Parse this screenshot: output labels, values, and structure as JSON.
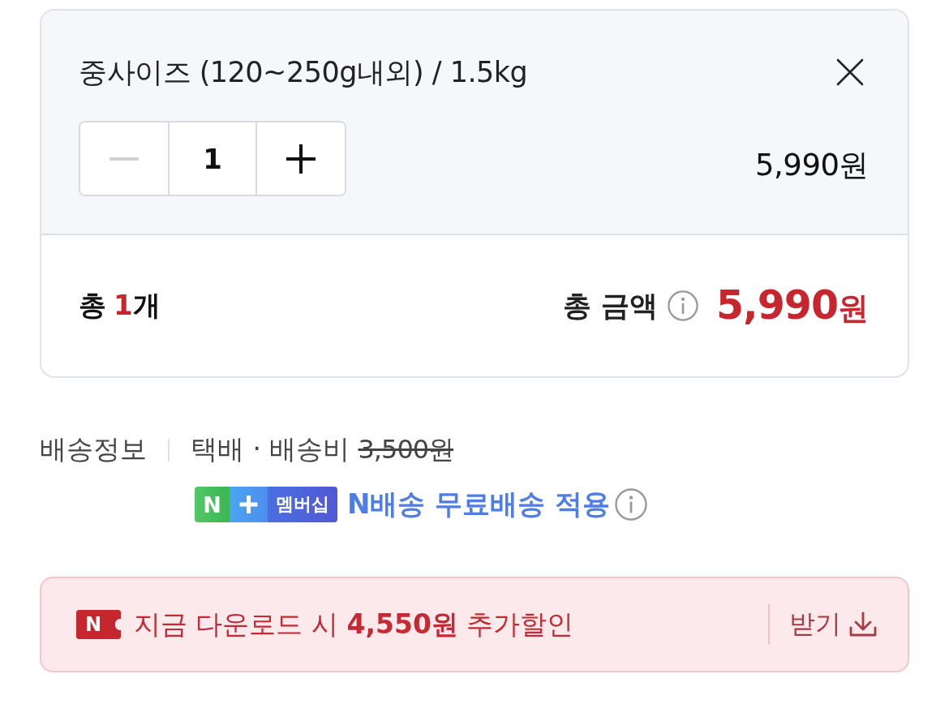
{
  "option": {
    "name": "중사이즈 (120~250g내외) / 1.5kg",
    "price": "5,990원"
  },
  "stepper": {
    "quantity": "1",
    "decrement_disabled": true,
    "increment_disabled": false
  },
  "summary": {
    "count_prefix": "총",
    "count": "1",
    "count_unit": "개",
    "total_label": "총 금액",
    "total_amount": "5,990",
    "total_unit": "원"
  },
  "shipping": {
    "label": "배송정보",
    "detail": "택배 · 배송비",
    "original_fee": "3,500원",
    "fee_struck": true,
    "membership_badge": {
      "letter": "N",
      "label": "멤버십"
    },
    "benefit": "N배송 무료배송 적용"
  },
  "coupon": {
    "tag": "N",
    "message": "지금 다운로드 시 **4,550원** 추가할인",
    "button": "받기"
  }
}
